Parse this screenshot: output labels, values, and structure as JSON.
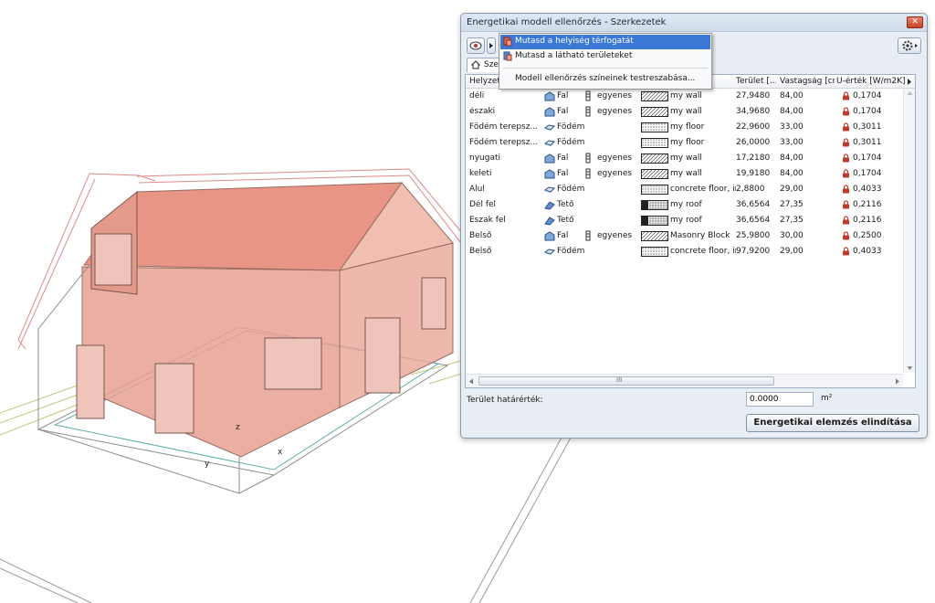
{
  "viewport_3d": {
    "axis_labels": {
      "x": "x",
      "y": "y",
      "z": "z"
    }
  },
  "window": {
    "title": "Energetikai modell ellenőrzés - Szerkezetek",
    "tab_label": "Sze",
    "menu": {
      "items": [
        {
          "label": "Mutasd a helyiség térfogatát",
          "selected": true,
          "icon": "room-volume-icon"
        },
        {
          "label": "Mutasd a látható területeket",
          "selected": false,
          "icon": "visible-area-icon"
        },
        {
          "label": "Modell ellenőrzés színeinek testreszabása...",
          "selected": false,
          "icon": ""
        }
      ]
    },
    "columns": [
      "Helyzet",
      "",
      "",
      "",
      "Terület [...",
      "Vastagság [cm]",
      "U-érték [W/m2K]"
    ],
    "rows": [
      {
        "position": "déli",
        "type": "Fal",
        "orientation": "egyenes",
        "material": "my wall",
        "area": "27,9480",
        "thickness": "84,00",
        "u_value": "0,1704",
        "swatch": "wall"
      },
      {
        "position": "északi",
        "type": "Fal",
        "orientation": "egyenes",
        "material": "my wall",
        "area": "34,9680",
        "thickness": "84,00",
        "u_value": "0,1704",
        "swatch": "wall"
      },
      {
        "position": "Födém terepsz...",
        "type": "Födém",
        "orientation": "",
        "material": "my floor",
        "area": "22,9600",
        "thickness": "33,00",
        "u_value": "0,3011",
        "swatch": "floor"
      },
      {
        "position": "Födém terepsz...",
        "type": "Födém",
        "orientation": "",
        "material": "my floor",
        "area": "26,0000",
        "thickness": "33,00",
        "u_value": "0,3011",
        "swatch": "floor"
      },
      {
        "position": "nyugati",
        "type": "Fal",
        "orientation": "egyenes",
        "material": "my wall",
        "area": "17,2180",
        "thickness": "84,00",
        "u_value": "0,1704",
        "swatch": "wall"
      },
      {
        "position": "keleti",
        "type": "Fal",
        "orientation": "egyenes",
        "material": "my wall",
        "area": "19,9180",
        "thickness": "84,00",
        "u_value": "0,1704",
        "swatch": "wall"
      },
      {
        "position": "Alul",
        "type": "Födém",
        "orientation": "",
        "material": "concrete floor, ins...",
        "area": "2,8800",
        "thickness": "29,00",
        "u_value": "0,4033",
        "swatch": "concrete"
      },
      {
        "position": "Dél fel",
        "type": "Tető",
        "orientation": "",
        "material": "my roof",
        "area": "36,6564",
        "thickness": "27,35",
        "u_value": "0,2116",
        "swatch": "roof"
      },
      {
        "position": "Észak fel",
        "type": "Tető",
        "orientation": "",
        "material": "my roof",
        "area": "36,6564",
        "thickness": "27,35",
        "u_value": "0,2116",
        "swatch": "roof"
      },
      {
        "position": "Belső",
        "type": "Fal",
        "orientation": "egyenes",
        "material": "Masonry Block",
        "area": "25,9800",
        "thickness": "30,00",
        "u_value": "0,2500",
        "swatch": "masonry"
      },
      {
        "position": "Belső",
        "type": "Födém",
        "orientation": "",
        "material": "concrete floor, ins...",
        "area": "97,9200",
        "thickness": "29,00",
        "u_value": "0,4033",
        "swatch": "concrete"
      }
    ],
    "scroll_marker": "III",
    "area_limit_label": "Terület határérték:",
    "area_limit_value": "0.0000",
    "area_limit_unit": "m²",
    "run_button": "Energetikai elemzés elindítása"
  },
  "colors": {
    "accent": "#3c79d6",
    "model_fill": "#e8907f",
    "u_icon": "#c0392b"
  }
}
